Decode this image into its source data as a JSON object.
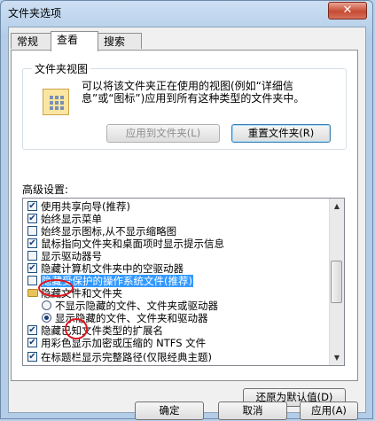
{
  "window": {
    "title": "文件夹选项",
    "close_glyph": "✕"
  },
  "tabs": [
    {
      "label": "常规",
      "active": false
    },
    {
      "label": "查看",
      "active": true
    },
    {
      "label": "搜索",
      "active": false
    }
  ],
  "folder_views": {
    "legend": "文件夹视图",
    "description": "可以将该文件夹正在使用的视图(例如“详细信息”或“图标”)应用到所有这种类型的文件夹中。",
    "apply_button": "应用到文件夹(L)",
    "reset_button": "重置文件夹(R)"
  },
  "advanced": {
    "label": "高级设置:",
    "items": [
      {
        "type": "checkbox",
        "checked": true,
        "label": "使用共享向导(推荐)"
      },
      {
        "type": "checkbox",
        "checked": true,
        "label": "始终显示菜单"
      },
      {
        "type": "checkbox",
        "checked": false,
        "label": "始终显示图标,从不显示缩略图"
      },
      {
        "type": "checkbox",
        "checked": true,
        "label": "鼠标指向文件夹和桌面项时显示提示信息"
      },
      {
        "type": "checkbox",
        "checked": false,
        "label": "显示驱动器号"
      },
      {
        "type": "checkbox",
        "checked": true,
        "label": "隐藏计算机文件夹中的空驱动器"
      },
      {
        "type": "checkbox",
        "checked": false,
        "label": "隐藏受保护的操作系统文件(推荐)",
        "selected": true
      },
      {
        "type": "folder",
        "label": "隐藏文件和文件夹"
      },
      {
        "type": "radio",
        "checked": false,
        "label": "不显示隐藏的文件、文件夹或驱动器"
      },
      {
        "type": "radio",
        "checked": true,
        "label": "显示隐藏的文件、文件夹和驱动器"
      },
      {
        "type": "checkbox",
        "checked": true,
        "label": "隐藏已知文件类型的扩展名"
      },
      {
        "type": "checkbox",
        "checked": true,
        "label": "用彩色显示加密或压缩的 NTFS 文件"
      },
      {
        "type": "checkbox",
        "checked": true,
        "label": "在标题栏显示完整路径(仅限经典主题)"
      }
    ],
    "check_glyph": "✔",
    "scroll_up_glyph": "▲",
    "scroll_down_glyph": "▼"
  },
  "restore_defaults_button": "还原为默认值(D)",
  "footer": {
    "ok": "确定",
    "cancel": "取消",
    "apply": "应用(A)"
  },
  "colors": {
    "annotation": "#e0141c",
    "selection": "#3399ff"
  }
}
